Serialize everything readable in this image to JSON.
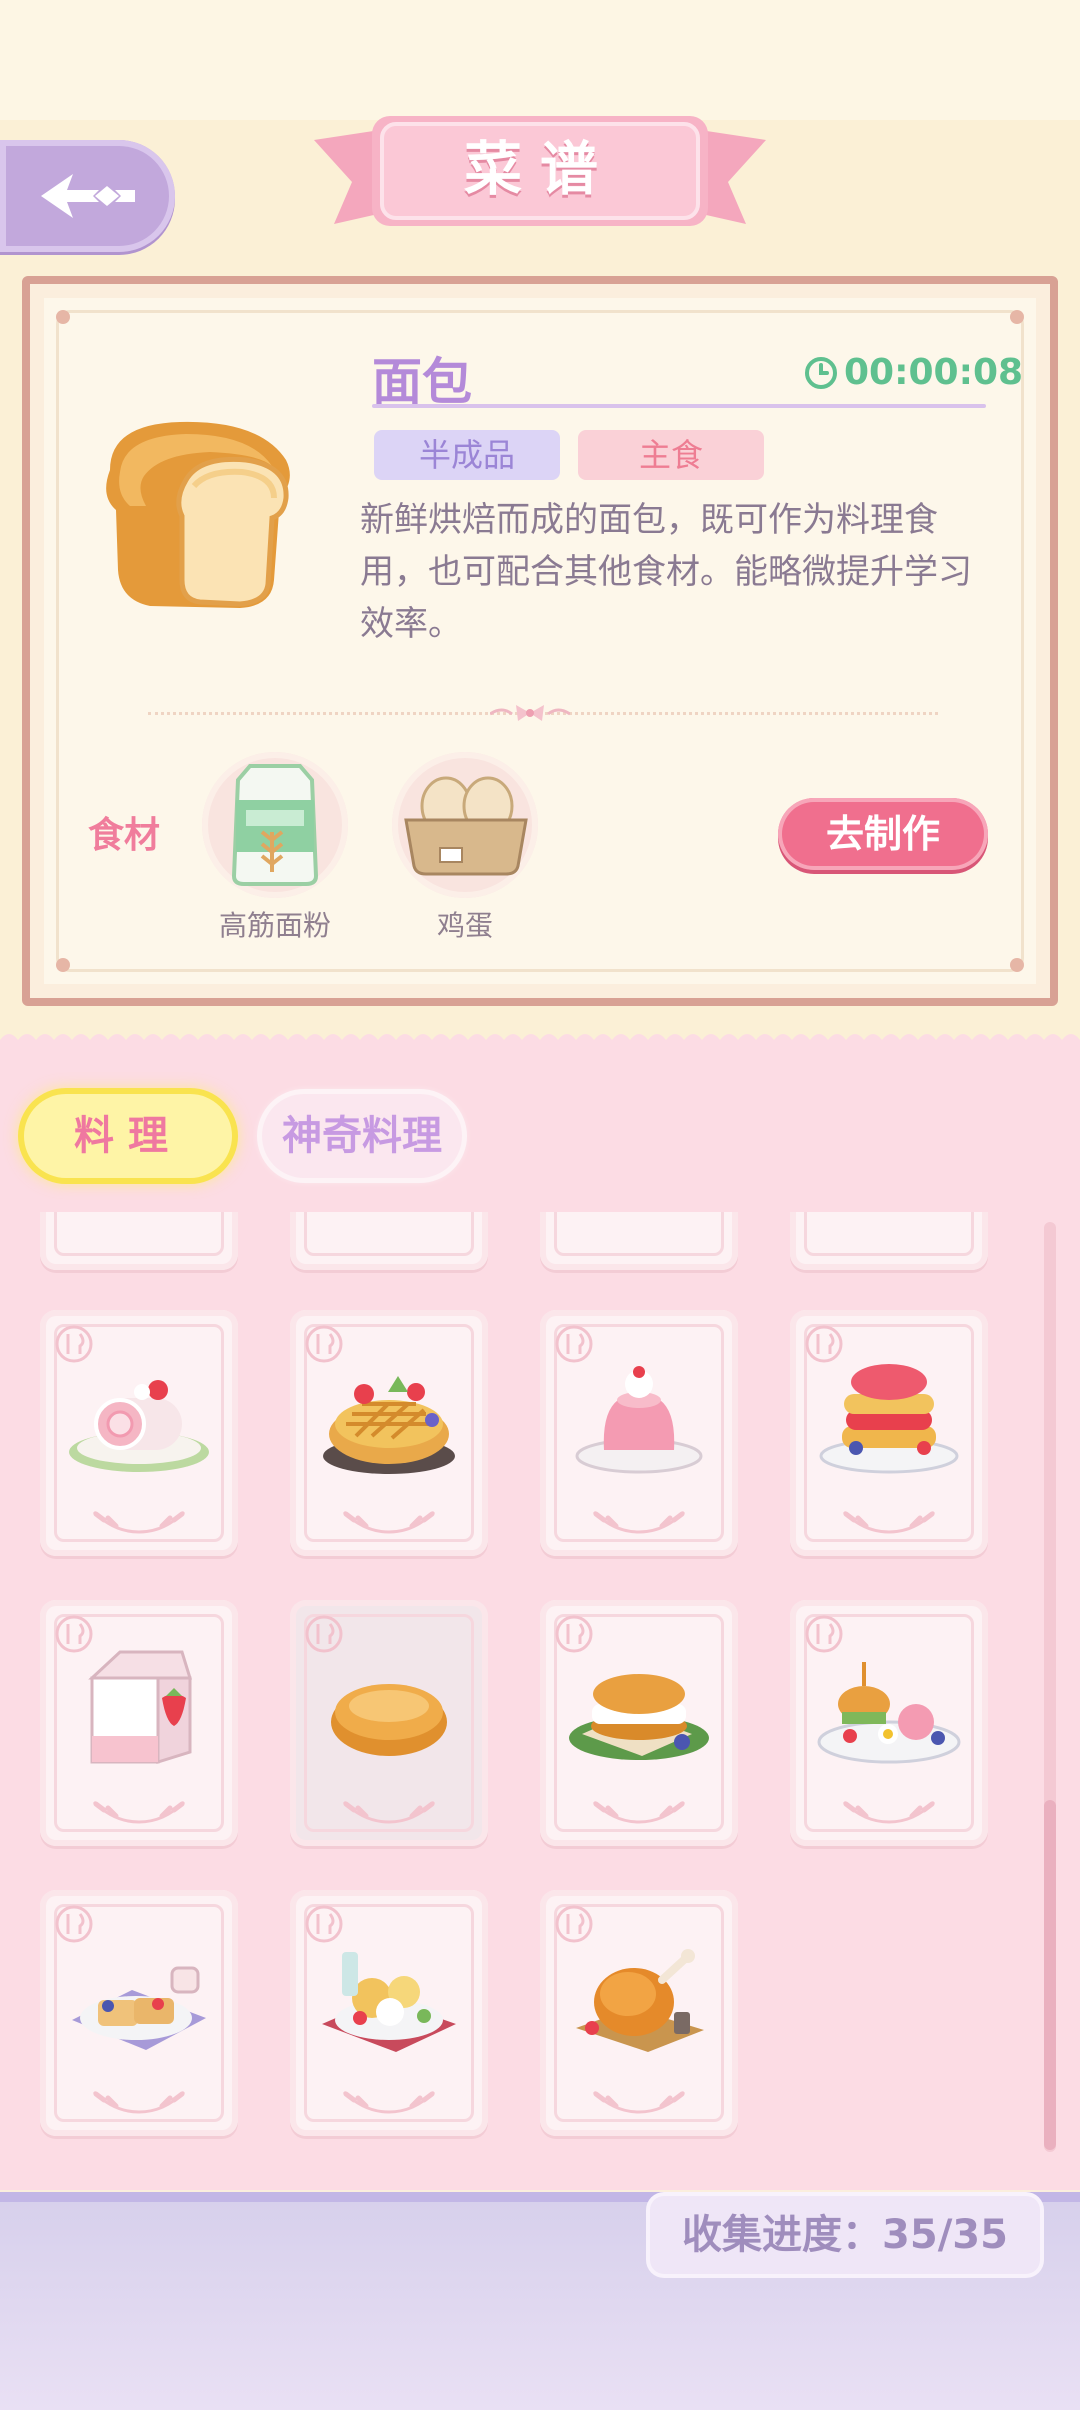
{
  "title": "菜谱",
  "detail": {
    "name": "面包",
    "timer": "00:00:08",
    "tags": [
      "半成品",
      "主食"
    ],
    "description": "新鲜烘焙而成的面包，既可作为料理食用，也可配合其他食材。能略微提升学习效率。",
    "ingredients_label": "食材",
    "ingredients": [
      {
        "name": "高筋面粉",
        "icon": "flour-bag-icon"
      },
      {
        "name": "鸡蛋",
        "icon": "egg-carton-icon"
      }
    ],
    "make_button": "去制作"
  },
  "tabs": [
    {
      "label": "料理",
      "active": true
    },
    {
      "label": "神奇料理",
      "active": false
    }
  ],
  "recipes": [
    {
      "icon": "strawberry-roll-cake-icon"
    },
    {
      "icon": "fruit-tart-icon"
    },
    {
      "icon": "strawberry-pudding-icon"
    },
    {
      "icon": "berry-pancakes-icon"
    },
    {
      "icon": "strawberry-milk-icon"
    },
    {
      "icon": "bread-icon",
      "selected": true
    },
    {
      "icon": "egg-sandwich-icon"
    },
    {
      "icon": "breakfast-platter-icon"
    },
    {
      "icon": "french-toast-icon"
    },
    {
      "icon": "fruit-salad-plate-icon"
    },
    {
      "icon": "roast-chicken-icon"
    }
  ],
  "progress": "收集进度：35/35",
  "colors": {
    "accent": "#f06f8e",
    "title": "#b48ad9",
    "timer": "#5fc08f",
    "tab_active": "#fef4a6"
  }
}
